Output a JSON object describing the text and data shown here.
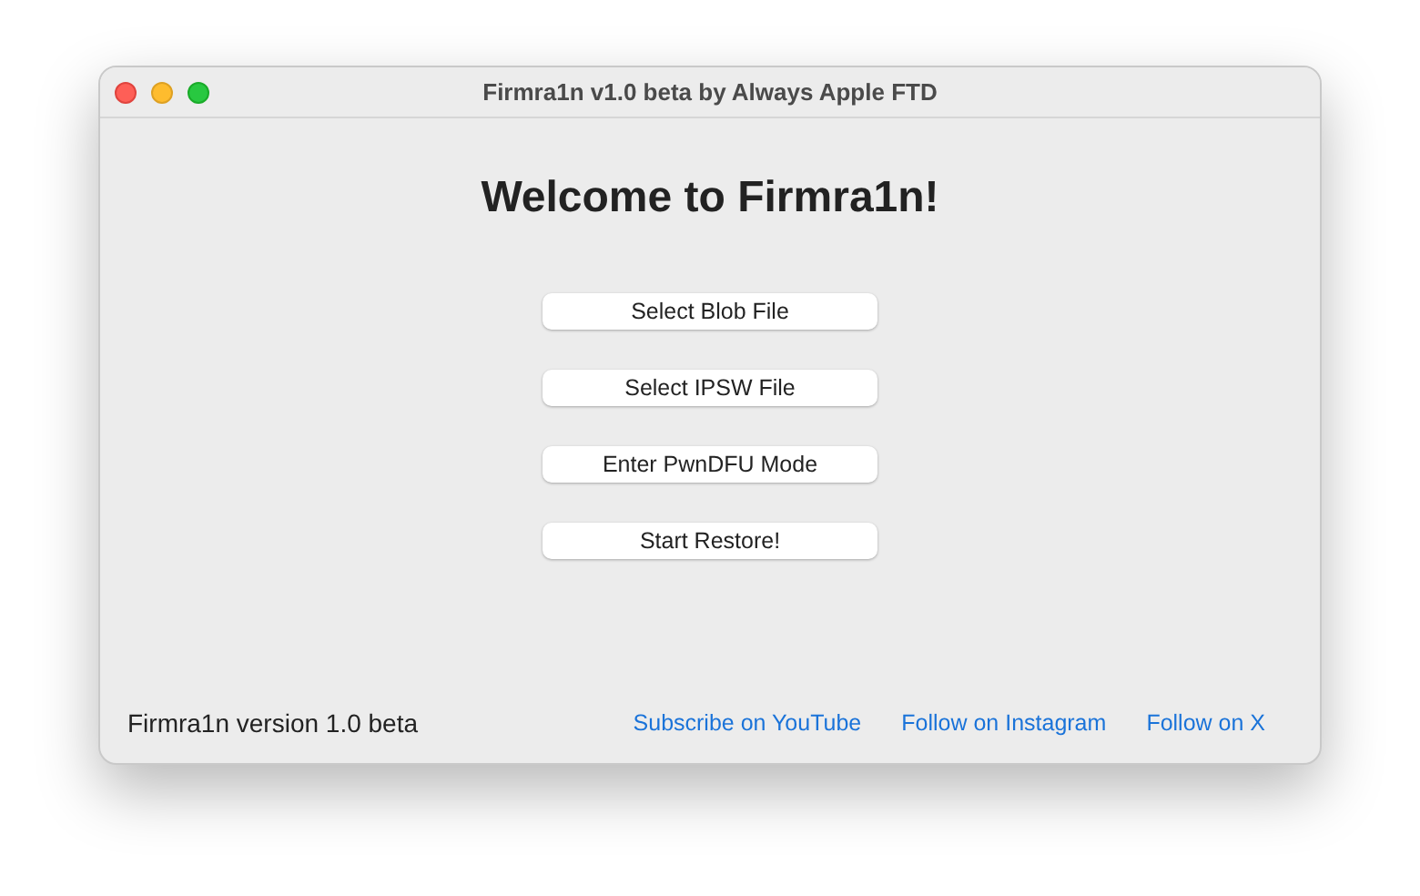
{
  "window": {
    "title": "Firmra1n v1.0 beta by Always Apple FTD"
  },
  "heading": "Welcome to Firmra1n!",
  "buttons": [
    "Select Blob File",
    "Select IPSW File",
    "Enter PwnDFU Mode",
    "Start Restore!"
  ],
  "footer": {
    "version": "Firmra1n version 1.0 beta",
    "links": [
      "Subscribe on YouTube",
      "Follow on Instagram",
      "Follow on X"
    ]
  }
}
